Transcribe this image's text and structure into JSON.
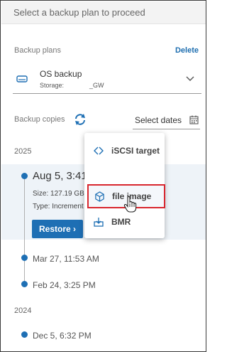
{
  "header": {
    "text": "Select a backup plan to proceed"
  },
  "plans": {
    "label": "Backup plans",
    "delete_label": "Delete",
    "selected": {
      "name": "OS backup",
      "storage_label": "Storage:",
      "storage_value": "_GW"
    }
  },
  "copies": {
    "label": "Backup copies",
    "dates_placeholder": "Select dates"
  },
  "years": [
    "2025",
    "2024"
  ],
  "selected_copy": {
    "title": "Aug 5, 3:41",
    "size": "Size: 127.19 GB",
    "type": "Type: Increment",
    "restore_label": "Restore ›"
  },
  "entries": [
    "Mar 27, 11:53 AM",
    "Feb 24, 3:25 PM",
    "Dec 5, 6:32 PM"
  ],
  "menu": {
    "items": [
      {
        "label": "iSCSI target",
        "icon": "iscsi-target-icon"
      },
      {
        "label": "file image",
        "icon": "cube-icon"
      },
      {
        "label": "BMR",
        "icon": "bmr-icon"
      }
    ]
  },
  "colors": {
    "accent": "#1e6fb4",
    "highlight": "#d8262e"
  }
}
